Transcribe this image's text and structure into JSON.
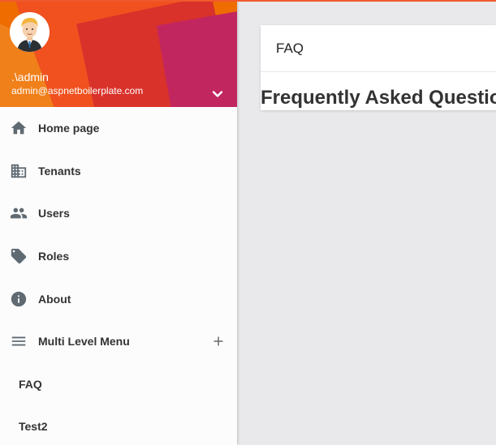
{
  "colors": {
    "accent_top_bar": "#f0592d",
    "sidebar_bg": "#fcfcfd",
    "content_bg": "#e9e9ec",
    "icon_color": "#5f6a72"
  },
  "user": {
    "name": ".\\admin",
    "email": "admin@aspnetboilerplate.com",
    "avatar_icon": "user-avatar",
    "menu_toggle_icon": "chevron-down-icon"
  },
  "sidebar": {
    "items": [
      {
        "label": "Home page",
        "icon": "home-icon"
      },
      {
        "label": "Tenants",
        "icon": "business-icon"
      },
      {
        "label": "Users",
        "icon": "people-icon"
      },
      {
        "label": "Roles",
        "icon": "tag-icon"
      },
      {
        "label": "About",
        "icon": "info-icon"
      },
      {
        "label": "Multi Level Menu",
        "icon": "menu-icon",
        "expand_icon": "plus-icon"
      }
    ],
    "subitems": [
      {
        "label": "FAQ"
      },
      {
        "label": "Test2"
      }
    ]
  },
  "main": {
    "card_title": "FAQ",
    "heading": "Frequently Asked Question"
  }
}
